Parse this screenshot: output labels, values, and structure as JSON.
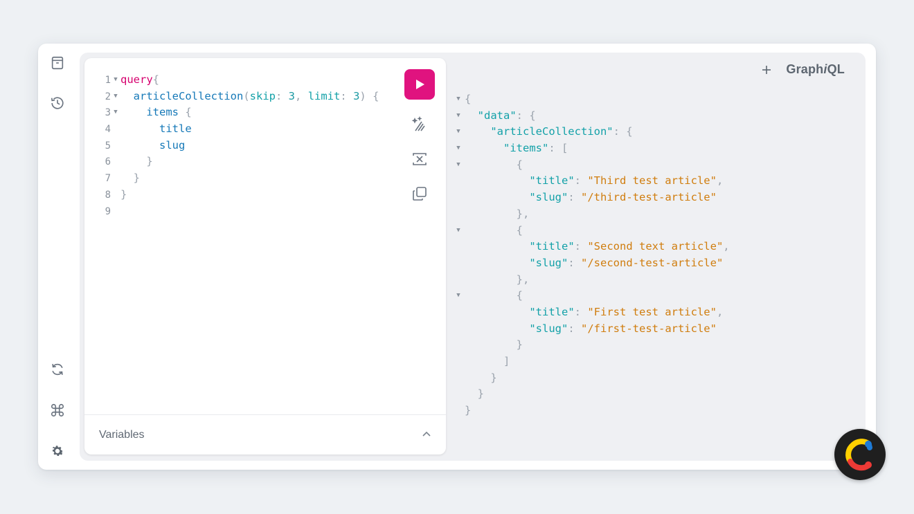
{
  "brand": {
    "prefix": "Graph",
    "italic": "i",
    "suffix": "QL"
  },
  "sidebar": {
    "top_icons": [
      "docs-icon",
      "history-icon"
    ],
    "bottom_icons": [
      "refetch-schema-icon",
      "shortcuts-icon",
      "settings-icon"
    ]
  },
  "editor": {
    "line_numbers": [
      "1",
      "2",
      "3",
      "4",
      "5",
      "6",
      "7",
      "8",
      "9"
    ],
    "tokens": {
      "query": "query",
      "brace_open": "{",
      "field_collection": "articleCollection",
      "paren_open": "(",
      "arg_skip": "skip",
      "colon": ":",
      "skip_value": "3",
      "comma": ",",
      "arg_limit": "limit",
      "limit_value": "3",
      "paren_close": ")",
      "field_items": "items",
      "field_title": "title",
      "field_slug": "slug",
      "brace_close": "}"
    }
  },
  "toolbar": {
    "run_label": "Execute query",
    "prettify_label": "Prettify",
    "merge_label": "Merge fragments",
    "copy_label": "Copy query"
  },
  "variables": {
    "label": "Variables"
  },
  "result": {
    "key_data": "\"data\"",
    "key_collection": "\"articleCollection\"",
    "key_items": "\"items\"",
    "key_title": "\"title\"",
    "key_slug": "\"slug\"",
    "items": [
      {
        "title": "\"Third test article\"",
        "slug": "\"/third-test-article\""
      },
      {
        "title": "\"Second text article\"",
        "slug": "\"/second-test-article\""
      },
      {
        "title": "\"First test article\"",
        "slug": "\"/first-test-article\""
      }
    ]
  },
  "colors": {
    "accent": "#e0137f",
    "keyword": "#d6006e",
    "field": "#1679b8",
    "argument": "#13a1a8",
    "string": "#d07d0e",
    "punctuation": "#9ba3ad"
  }
}
